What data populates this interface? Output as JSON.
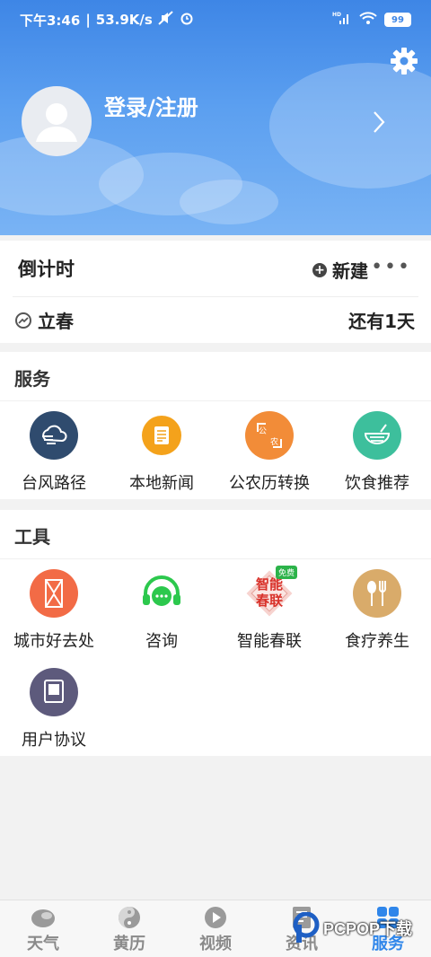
{
  "status_bar": {
    "time": "下午3:46",
    "speed": "53.9K/s",
    "network": "HD",
    "battery": "99"
  },
  "header": {
    "login_text": "登录/注册"
  },
  "countdown": {
    "title": "倒计时",
    "new_label": "新建",
    "more_label": "•••",
    "term_name": "立春",
    "remain_text": "还有1天"
  },
  "services": {
    "title": "服务",
    "items": [
      {
        "label": "台风路径",
        "color": "#2f4b6e",
        "icon": "typhoon-icon"
      },
      {
        "label": "本地新闻",
        "color": "#f4a21b",
        "icon": "news-icon"
      },
      {
        "label": "公农历转换",
        "color": "#f28c38",
        "icon": "calendar-convert-icon"
      },
      {
        "label": "饮食推荐",
        "color": "#3dbf9c",
        "icon": "food-bowl-icon"
      }
    ]
  },
  "tools": {
    "title": "工具",
    "items": [
      {
        "label": "城市好去处",
        "color": "#f26b46",
        "icon": "city-icon"
      },
      {
        "label": "咨询",
        "color": "#2cc84d",
        "icon": "chat-icon"
      },
      {
        "label": "智能春联",
        "color": "#d9322b",
        "icon": "couplet-icon",
        "badge": "免费",
        "art_text": "智能春联"
      },
      {
        "label": "食疗养生",
        "color": "#d9ab6a",
        "icon": "spoon-fork-icon"
      },
      {
        "label": "用户协议",
        "color": "#5d5a7c",
        "icon": "agreement-icon"
      }
    ]
  },
  "bottom_nav": {
    "items": [
      {
        "label": "天气",
        "icon": "weather-icon"
      },
      {
        "label": "黄历",
        "icon": "almanac-icon"
      },
      {
        "label": "视频",
        "icon": "video-icon"
      },
      {
        "label": "资讯",
        "icon": "info-icon"
      },
      {
        "label": "服务",
        "icon": "service-icon",
        "active": true
      }
    ],
    "accent": "#2f86ea"
  },
  "watermark": {
    "text": "PCPOP下载"
  }
}
